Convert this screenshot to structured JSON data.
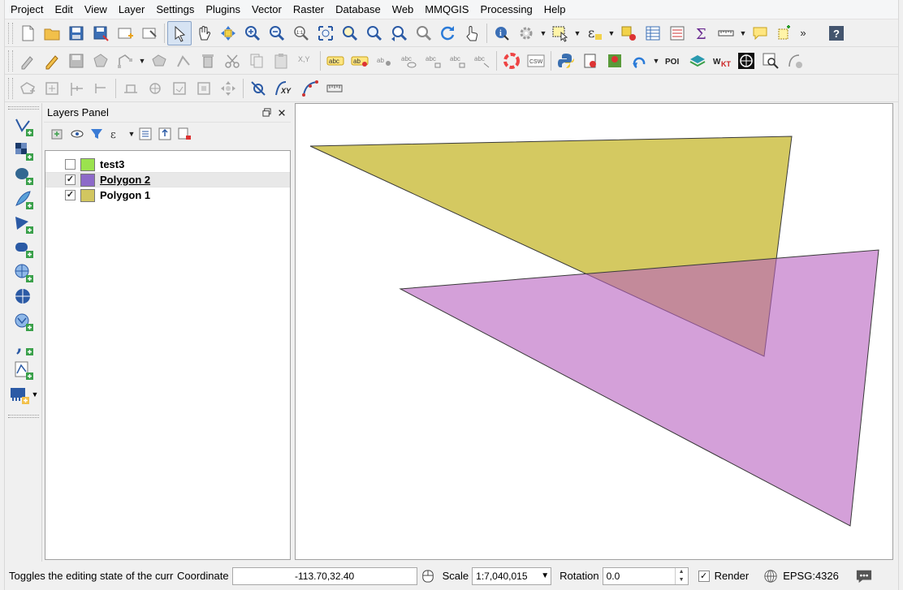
{
  "menubar": {
    "items": [
      "Project",
      "Edit",
      "View",
      "Layer",
      "Settings",
      "Plugins",
      "Vector",
      "Raster",
      "Database",
      "Web",
      "MMQGIS",
      "Processing",
      "Help"
    ]
  },
  "toolbar": {
    "csw_label": "CSW",
    "poi_label": "POI",
    "wkt_label": "WKT",
    "xy_label": "XY",
    "abc_label": "abc",
    "more_label": "»",
    "help_label": "?"
  },
  "layers_panel": {
    "title": "Layers Panel",
    "layers": [
      {
        "name": "test3",
        "checked": false,
        "color": "#9be24e",
        "selected": false
      },
      {
        "name": "Polygon 2",
        "checked": true,
        "color": "#8d6ac9",
        "selected": true
      },
      {
        "name": "Polygon 1",
        "checked": true,
        "color": "#d2c660",
        "selected": false
      }
    ]
  },
  "map": {
    "polygon1_color": "#cdbf45",
    "polygon2_color": "#b860c0"
  },
  "statusbar": {
    "message": "Toggles the editing state of the curr",
    "coordinate_label": "Coordinate",
    "coordinate_value": "-113.70,32.40",
    "scale_label": "Scale",
    "scale_value": "1:7,040,015",
    "rotation_label": "Rotation",
    "rotation_value": "0.0",
    "render_label": "Render",
    "render_checked": true,
    "crs_label": "EPSG:4326"
  }
}
